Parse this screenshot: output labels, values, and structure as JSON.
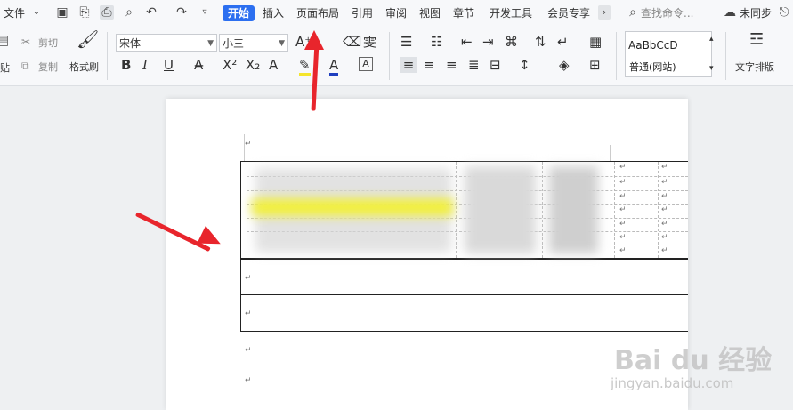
{
  "menubar": {
    "file": "文件",
    "tabs": [
      "开始",
      "插入",
      "页面布局",
      "引用",
      "审阅",
      "视图",
      "章节",
      "开发工具",
      "会员专享"
    ],
    "search_placeholder": "查找命令...",
    "sync": "未同步"
  },
  "ribbon": {
    "cut": "剪切",
    "copy": "复制",
    "paste_short": "贴",
    "format_painter": "格式刷",
    "font_name": "宋体",
    "font_size": "小三",
    "style_preview": "AaBbCcD",
    "style_name": "普通(网站)",
    "text_layout": "文字排版"
  },
  "document": {
    "paragraph_mark": "↵"
  },
  "watermark": {
    "brand": "Bai du 经验",
    "url": "jingyan.baidu.com"
  }
}
